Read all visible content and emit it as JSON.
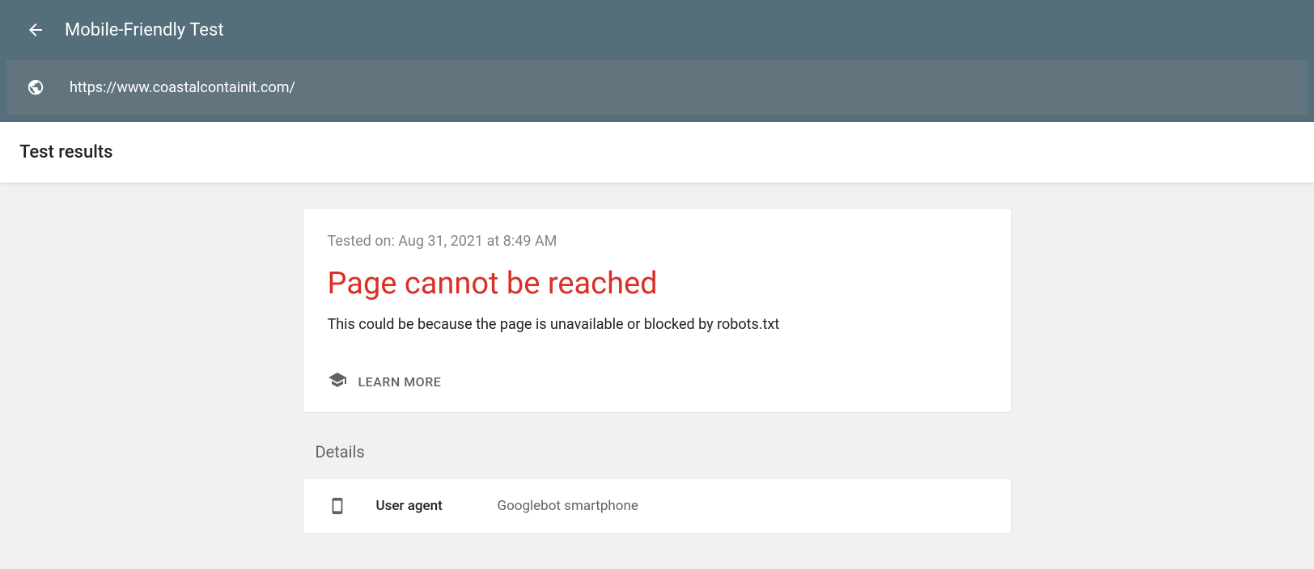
{
  "header": {
    "title": "Mobile-Friendly Test"
  },
  "urlbar": {
    "url": "https://www.coastalcontainit.com/"
  },
  "tabs": {
    "results_label": "Test results"
  },
  "result": {
    "tested_on": "Tested on: Aug 31, 2021 at 8:49 AM",
    "status_title": "Page cannot be reached",
    "status_description": "This could be because the page is unavailable or blocked by robots.txt",
    "learn_more_label": "LEARN MORE"
  },
  "details": {
    "section_label": "Details",
    "rows": [
      {
        "key": "User agent",
        "value": "Googlebot smartphone"
      }
    ]
  }
}
